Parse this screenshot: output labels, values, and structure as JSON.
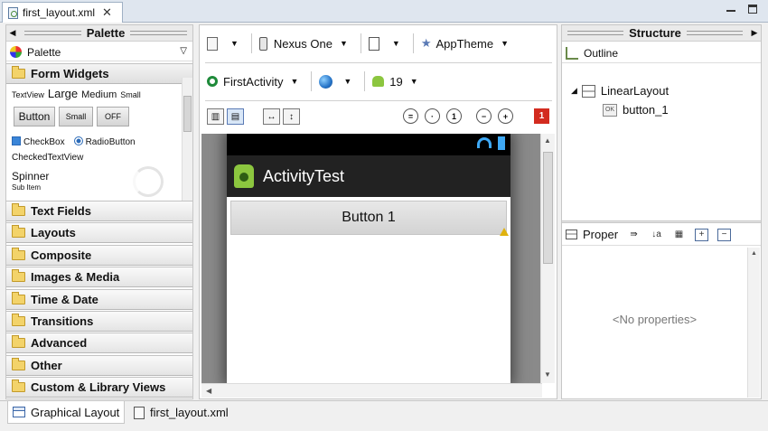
{
  "editor": {
    "tab_title": "first_layout.xml",
    "close_glyph": "✕"
  },
  "palette": {
    "header": "Palette",
    "selector_label": "Palette",
    "categories": [
      {
        "label": "Form Widgets",
        "expanded": true
      },
      {
        "label": "Text Fields"
      },
      {
        "label": "Layouts"
      },
      {
        "label": "Composite"
      },
      {
        "label": "Images & Media"
      },
      {
        "label": "Time & Date"
      },
      {
        "label": "Transitions"
      },
      {
        "label": "Advanced"
      },
      {
        "label": "Other"
      },
      {
        "label": "Custom & Library Views"
      }
    ],
    "widgets": {
      "textview": "TextView",
      "large": "Large",
      "medium": "Medium",
      "small_text": "Small",
      "button": "Button",
      "small_button": "Small",
      "toggle": "OFF",
      "checkbox": "CheckBox",
      "radiobutton": "RadioButton",
      "checkedtextview": "CheckedTextView",
      "spinner": "Spinner",
      "spinner_sub": "Sub Item"
    }
  },
  "toolbar": {
    "device": "Nexus One",
    "theme": "AppTheme",
    "activity": "FirstActivity",
    "api_level": "19",
    "error_count": "1"
  },
  "preview": {
    "action_bar_title": "ActivityTest",
    "button_label": "Button 1"
  },
  "structure": {
    "header": "Structure",
    "outline_label": "Outline",
    "tree": [
      {
        "label": "LinearLayout"
      },
      {
        "label": "button_1"
      }
    ],
    "properties_label": "Proper",
    "no_properties": "<No properties>"
  },
  "bottom_tabs": [
    {
      "label": "Graphical Layout",
      "active": true
    },
    {
      "label": "first_layout.xml",
      "active": false
    }
  ]
}
